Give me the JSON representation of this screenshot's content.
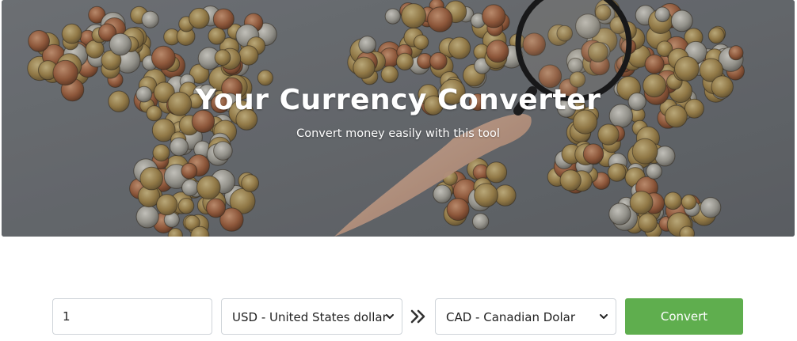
{
  "hero": {
    "title": "Your Currency Converter",
    "subtitle": "Convert money easily with this tool",
    "background_image": "world map made of coins with hand holding magnifying glass"
  },
  "converter": {
    "amount_value": "1",
    "from_currency": "USD - United States dollar",
    "to_currency": "CAD - Canadian Dolar",
    "swap_icon": "double-chevron-right-icon",
    "convert_label": "Convert"
  },
  "colors": {
    "hero_bg": "#6f7377",
    "convert_button": "#5fae4e",
    "border": "#cfd4d9"
  }
}
